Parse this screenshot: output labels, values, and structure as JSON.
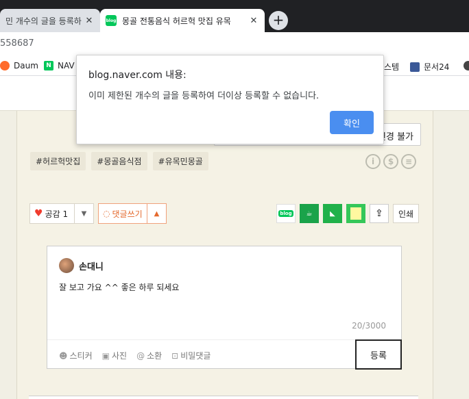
{
  "browser": {
    "tabs": [
      {
        "title": "민 개수의 글을 등록하",
        "close": "✕"
      },
      {
        "title": "몽골 전통음식 허르헉 맛집 유목",
        "close": "✕",
        "favicon": "blog"
      }
    ],
    "new_tab": "+",
    "url": "558687",
    "bookmarks": [
      {
        "label": "Daum"
      },
      {
        "label": "NAV"
      },
      {
        "label": "스템"
      },
      {
        "label": "문서24"
      }
    ]
  },
  "alert": {
    "title": "blog.naver.com 내용:",
    "message": "이미 제한된 개수의 글을 등록하여 더이상 등록할 수 없습니다.",
    "ok_label": "확인"
  },
  "post": {
    "tooltip_text": "변경 불가",
    "tags": [
      "#허르헉맛집",
      "#몽골음식점",
      "#유목민몽골"
    ],
    "like_label": "공감 1",
    "comment_label": "댓글쓰기",
    "print_label": "인쇄",
    "share_blog_label": "blog"
  },
  "comment_box": {
    "username": "손대니",
    "text": "잘 보고 가요 ^^ 좋은 하루 되세요",
    "count": "20/3000",
    "tools": [
      "스티커",
      "사진",
      "소환",
      "비밀댓글"
    ],
    "submit_label": "등록"
  },
  "colors": {
    "accent_button": "#4a8ef0",
    "naver_green": "#03c75a",
    "heart": "#f03c2e",
    "comment_orange": "#e46a2e"
  }
}
